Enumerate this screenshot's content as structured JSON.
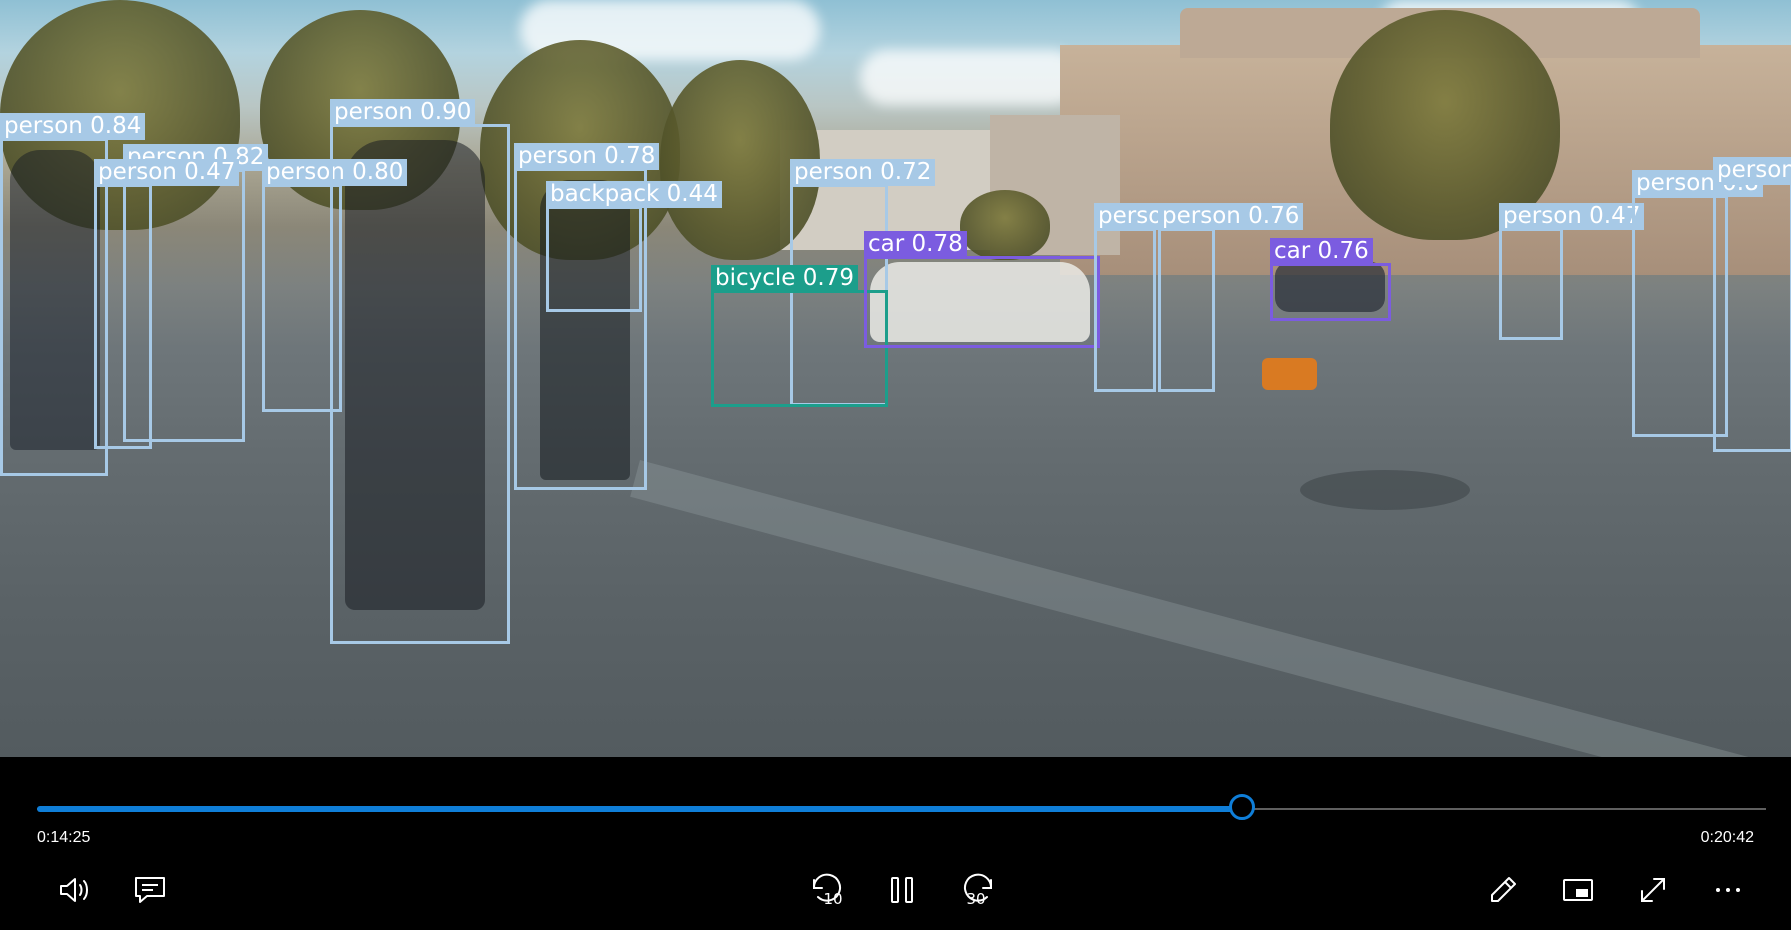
{
  "player": {
    "position": "0:14:25",
    "duration": "0:20:42",
    "progress_fraction": 0.697,
    "accent_color": "#0f7ed8"
  },
  "detections": [
    {
      "label": "person 0.84",
      "color": "#a7c9e6"
    },
    {
      "label": "person 0.82",
      "color": "#a7c9e6"
    },
    {
      "label": "person 0.47",
      "color": "#a7c9e6"
    },
    {
      "label": "person 0.80",
      "color": "#a7c9e6"
    },
    {
      "label": "person 0.90",
      "color": "#a7c9e6"
    },
    {
      "label": "person 0.78",
      "color": "#a7c9e6"
    },
    {
      "label": "backpack 0.44",
      "color": "#a7c9e6"
    },
    {
      "label": "person 0.72",
      "color": "#a7c9e6"
    },
    {
      "label": "bicycle 0.79",
      "color": "#1c9e8b"
    },
    {
      "label": "car 0.78",
      "color": "#7b5ce0"
    },
    {
      "label": "person",
      "color": "#a7c9e6"
    },
    {
      "label": "person 0.76",
      "color": "#a7c9e6"
    },
    {
      "label": "car 0.76",
      "color": "#7b5ce0"
    },
    {
      "label": "person 0.47",
      "color": "#a7c9e6"
    },
    {
      "label": "person 0.8",
      "color": "#a7c9e6"
    },
    {
      "label": "person",
      "color": "#a7c9e6"
    }
  ],
  "controls": {
    "volume_icon": "speaker-icon",
    "captions_icon": "captions-icon",
    "skip_back_icon": "skip-back-10-icon",
    "skip_back_seconds": "10",
    "play_pause_icon": "pause-icon",
    "skip_forward_icon": "skip-forward-30-icon",
    "skip_forward_seconds": "30",
    "edit_icon": "pencil-icon",
    "mini_view_icon": "mini-view-icon",
    "fullscreen_icon": "fullscreen-icon",
    "more_icon": "more-icon"
  }
}
